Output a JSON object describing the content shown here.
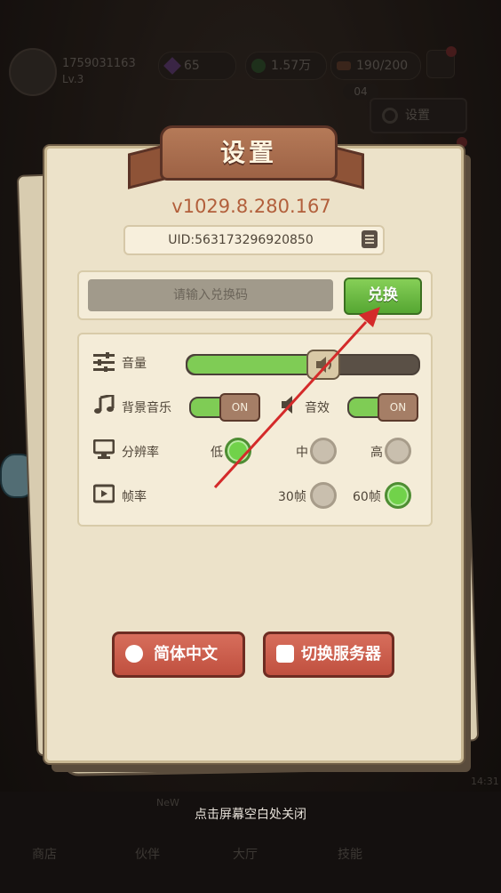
{
  "background": {
    "player": {
      "id": "1759031163",
      "level": "Lv.3"
    },
    "currencies": {
      "gems": "65",
      "coins": "1.57万",
      "energy": "190/200"
    },
    "side_button": {
      "timer": "04",
      "label": "设置"
    },
    "nav": [
      "商店",
      "伙伴",
      "大厅",
      "技能"
    ],
    "nav_badge": "NeW",
    "time_label": "14:31"
  },
  "dialog": {
    "title": "设置",
    "version": "v1029.8.280.167",
    "uid": "UID:563173296920850",
    "redeem": {
      "placeholder": "请输入兑换码",
      "button": "兑换"
    },
    "settings": {
      "volume_label": "音量",
      "volume_level": 0.58,
      "bgm_label": "背景音乐",
      "bgm_state": "ON",
      "sfx_label": "音效",
      "sfx_state": "ON",
      "resolution_label": "分辨率",
      "resolution_options": [
        "低",
        "中",
        "高"
      ],
      "resolution_selected": "低",
      "fps_label": "帧率",
      "fps_options": [
        "30帧",
        "60帧"
      ],
      "fps_selected": "60帧"
    },
    "language_button": "简体中文",
    "server_button": "切换服务器"
  },
  "close_hint": "点击屏幕空白处关闭",
  "colors": {
    "accent_green": "#7fcc55",
    "button_red": "#c85a48",
    "panel": "#ece2c9",
    "version": "#b25f3b",
    "arrow": "#d42a2a"
  }
}
